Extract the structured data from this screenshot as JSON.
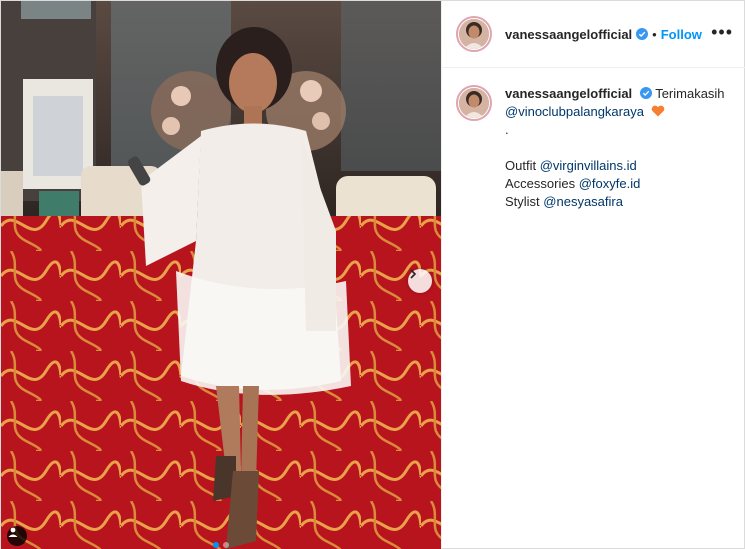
{
  "header": {
    "username": "vanessaangelofficial",
    "separator": "•",
    "follow_label": "Follow",
    "more_label": "•••",
    "avatar_icon": "profile-avatar"
  },
  "caption": {
    "username": "vanessaangelofficial",
    "text_intro": "Terimakasih",
    "mention_club": "@vinoclubpalangkaraya",
    "dot_line": ".",
    "outfit_label": "Outfit",
    "outfit_mention": "@virginvillains.id",
    "accessories_label": "Accessories",
    "accessories_mention": "@foxyfe.id",
    "stylist_label": "Stylist",
    "stylist_mention": "@nesyasafira",
    "emoji": "orange-heart-icon"
  },
  "carousel": {
    "total_slides": 2,
    "active_slide": 1,
    "next_icon": "chevron-right-icon",
    "tag_icon": "user-tag-icon"
  },
  "colors": {
    "accent": "#0095f6",
    "mention": "#00376b",
    "verified": "#3897f0",
    "heart": "#f77f2f"
  }
}
